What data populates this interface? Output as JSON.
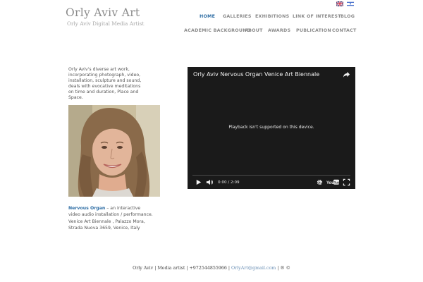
{
  "header": {
    "title": "Orly Aviv Art",
    "tagline": "Orly Aviv Digital Media Artist"
  },
  "language_flags": [
    {
      "icon": "uk-flag-icon",
      "language": "English"
    },
    {
      "icon": "israel-flag-icon",
      "language": "Hebrew"
    }
  ],
  "nav": {
    "row1": [
      "HOME",
      "GALLERIES",
      "EXHIBITIONS",
      "LINK OF INTEREST",
      "BLOG"
    ],
    "row2": [
      "ACADEMIC BACKGROUND",
      "ABOUT",
      "AWARDS",
      "PUBLICATION",
      "CONTACT"
    ],
    "active": "HOME",
    "active_color": "#2e6da4"
  },
  "bio": {
    "text": "Orly Aviv's diverse art work, incorporating photograph, video, installation, sculpture and sound, deals with evocative meditations on time and duration, Place and Space."
  },
  "caption": {
    "link": "Nervous Organ",
    "text": " – an interactive video audio installation / performance. Venice Art Biennale , Palazzo Mora, Strada Nuova 3659, Venice, Italy"
  },
  "video": {
    "title": "Orly Aviv Nervous Organ Venice Art Biennale",
    "message": "Playback isn't supported on this device.",
    "time": "0:00 / 2:09",
    "brand": "YouTube",
    "icons": [
      "share-icon",
      "play-icon",
      "volume-icon",
      "settings-icon",
      "youtube-logo",
      "fullscreen-icon"
    ]
  },
  "footer": {
    "prefix": "Orly Aviv | Media artist | +972544855966 | ",
    "email": "OrlyArt@gmail.com",
    "suffix": " | ® ©"
  }
}
